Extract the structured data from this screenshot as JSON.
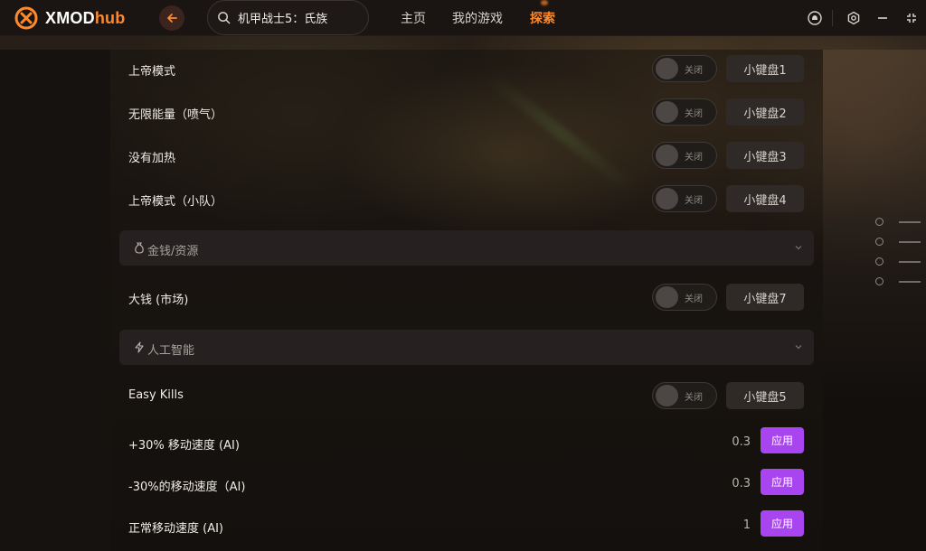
{
  "app": {
    "logo_prefix": "XMOD",
    "logo_suffix": "hub"
  },
  "search": {
    "value": "机甲战士5：氏族"
  },
  "nav": {
    "home": "主页",
    "my_games": "我的游戏",
    "explore": "探索"
  },
  "colors": {
    "accent": "#ff8a2b",
    "apply_button": "#a845f0"
  },
  "mods": [
    {
      "label": "上帝模式",
      "toggle": "关闭",
      "hotkey": "小键盘1"
    },
    {
      "label": "无限能量（喷气）",
      "toggle": "关闭",
      "hotkey": "小键盘2"
    },
    {
      "label": "没有加热",
      "toggle": "关闭",
      "hotkey": "小键盘3"
    },
    {
      "label": "上帝模式（小队）",
      "toggle": "关闭",
      "hotkey": "小键盘4"
    }
  ],
  "section_money": {
    "title": "金钱/资源",
    "icon": "coin-bag-icon",
    "items": [
      {
        "label": "大钱 (市场)",
        "toggle": "关闭",
        "hotkey": "小键盘7"
      }
    ]
  },
  "section_ai": {
    "title": "人工智能",
    "icon": "bolt-icon",
    "items": [
      {
        "label": "Easy Kills",
        "toggle": "关闭",
        "hotkey": "小键盘5"
      }
    ],
    "value_items": [
      {
        "label": "+30% 移动速度 (AI)",
        "value": "0.3",
        "button": "应用"
      },
      {
        "label": "-30%的移动速度（AI)",
        "value": "0.3",
        "button": "应用"
      },
      {
        "label": "正常移动速度 (AI)",
        "value": "1",
        "button": "应用"
      }
    ]
  },
  "window_icons": [
    "notification-icon",
    "settings-icon",
    "minimize-icon",
    "fullscreen-icon"
  ]
}
